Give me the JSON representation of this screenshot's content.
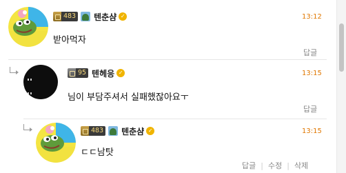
{
  "comments": [
    {
      "level": "483",
      "username": "텐춘샴",
      "time": "13:12",
      "text": "받아먹자",
      "actions": [
        "답글"
      ]
    },
    {
      "level": "95",
      "username": "텐헤응",
      "time": "13:15",
      "text": "님이 부담주셔서 실패했잖아요ㅜ",
      "actions": [
        "답글"
      ]
    },
    {
      "level": "483",
      "username": "텐춘샴",
      "time": "13:15",
      "text": "ㄷㄷ남탓",
      "actions": [
        "답글",
        "수정",
        "삭제"
      ]
    }
  ],
  "colors": {
    "time": "#e07700",
    "level_text": "#f5d67a",
    "verified": "#f0b400"
  },
  "icons": {
    "level": "crown-level-icon",
    "verified": "verified-check-icon",
    "reply": "reply-arrow-icon"
  }
}
